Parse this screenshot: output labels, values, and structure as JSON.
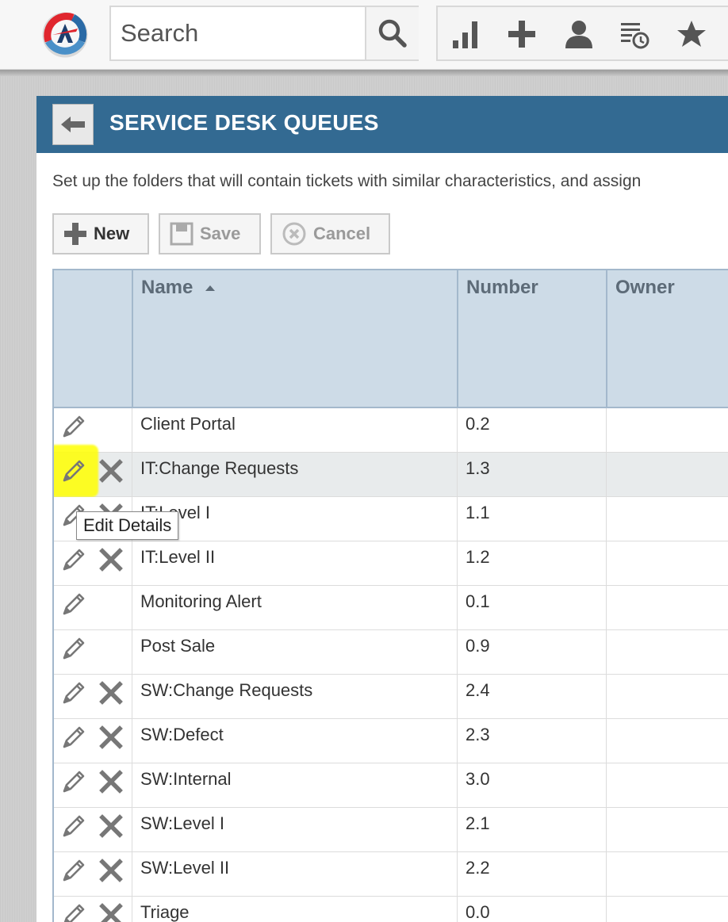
{
  "app": {
    "logo_icon": "app-logo-icon",
    "search": {
      "placeholder": "Search",
      "icon": "search-icon"
    },
    "toolbar": [
      {
        "name": "reports",
        "icon": "bar-chart-icon"
      },
      {
        "name": "add",
        "icon": "plus-icon"
      },
      {
        "name": "user",
        "icon": "user-icon"
      },
      {
        "name": "recent",
        "icon": "list-clock-icon"
      },
      {
        "name": "favorites",
        "icon": "star-icon"
      }
    ]
  },
  "page": {
    "title": "SERVICE DESK QUEUES",
    "description": "Set up the folders that will contain tickets with similar characteristics, and assign",
    "buttons": {
      "new_label": "New",
      "save_label": "Save",
      "cancel_label": "Cancel"
    }
  },
  "table": {
    "columns": {
      "name": "Name",
      "number": "Number",
      "owner": "Owner"
    },
    "sort": {
      "column": "Name",
      "direction": "ascending"
    },
    "rows": [
      {
        "name": "Client Portal",
        "number": "0.2",
        "owner": "",
        "deletable": false
      },
      {
        "name": "IT:Change Requests",
        "number": "1.3",
        "owner": "",
        "deletable": true
      },
      {
        "name": "IT:Level I",
        "number": "1.1",
        "owner": "",
        "deletable": true
      },
      {
        "name": "IT:Level II",
        "number": "1.2",
        "owner": "",
        "deletable": true
      },
      {
        "name": "Monitoring Alert",
        "number": "0.1",
        "owner": "",
        "deletable": false
      },
      {
        "name": "Post Sale",
        "number": "0.9",
        "owner": "",
        "deletable": false
      },
      {
        "name": "SW:Change Requests",
        "number": "2.4",
        "owner": "",
        "deletable": true
      },
      {
        "name": "SW:Defect",
        "number": "2.3",
        "owner": "",
        "deletable": true
      },
      {
        "name": "SW:Internal",
        "number": "3.0",
        "owner": "",
        "deletable": true
      },
      {
        "name": "SW:Level I",
        "number": "2.1",
        "owner": "",
        "deletable": true
      },
      {
        "name": "SW:Level II",
        "number": "2.2",
        "owner": "",
        "deletable": true
      },
      {
        "name": "Triage",
        "number": "0.0",
        "owner": "",
        "deletable": true
      }
    ],
    "hovered_row": 1
  },
  "tooltip": {
    "text": "Edit Details"
  },
  "colors": {
    "header_bar": "#336a92",
    "table_header": "#cddbe7",
    "highlight": "#ffff00"
  }
}
